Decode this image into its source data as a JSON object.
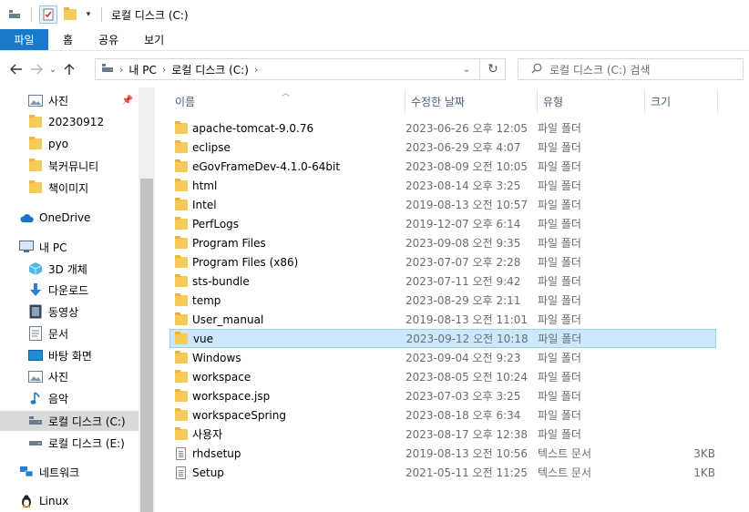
{
  "window": {
    "title": "로컬 디스크 (C:)"
  },
  "ribbon": {
    "tabs": [
      "파일",
      "홈",
      "공유",
      "보기"
    ]
  },
  "address": {
    "crumbs": [
      "내 PC",
      "로컬 디스크 (C:)"
    ],
    "search_placeholder": "로컬 디스크 (C:) 검색"
  },
  "nav": {
    "quick_access": [
      {
        "label": "사진",
        "icon": "pictures-icon",
        "pinned": true
      },
      {
        "label": "20230912",
        "icon": "folder-icon"
      },
      {
        "label": "pyo",
        "icon": "folder-icon"
      },
      {
        "label": "북커뮤니티",
        "icon": "folder-icon"
      },
      {
        "label": "책이미지",
        "icon": "folder-icon"
      }
    ],
    "onedrive": "OneDrive",
    "this_pc": "내 PC",
    "pc_items": [
      {
        "label": "3D 개체",
        "icon": "3d-objects-icon"
      },
      {
        "label": "다운로드",
        "icon": "downloads-icon"
      },
      {
        "label": "동영상",
        "icon": "videos-icon"
      },
      {
        "label": "문서",
        "icon": "documents-icon"
      },
      {
        "label": "바탕 화면",
        "icon": "desktop-icon"
      },
      {
        "label": "사진",
        "icon": "pictures-icon"
      },
      {
        "label": "음악",
        "icon": "music-icon"
      },
      {
        "label": "로컬 디스크 (C:)",
        "icon": "drive-icon",
        "selected": true
      },
      {
        "label": "로컬 디스크 (E:)",
        "icon": "drive-icon"
      }
    ],
    "network": "네트워크",
    "linux": "Linux"
  },
  "columns": {
    "name": "이름",
    "date": "수정한 날짜",
    "type": "유형",
    "size": "크기"
  },
  "files": [
    {
      "name": "apache-tomcat-9.0.76",
      "date": "2023-06-26 오후 12:05",
      "type": "파일 폴더",
      "size": "",
      "kind": "folder"
    },
    {
      "name": "eclipse",
      "date": "2023-06-29 오후 4:07",
      "type": "파일 폴더",
      "size": "",
      "kind": "folder"
    },
    {
      "name": "eGovFrameDev-4.1.0-64bit",
      "date": "2023-08-09 오전 10:05",
      "type": "파일 폴더",
      "size": "",
      "kind": "folder"
    },
    {
      "name": "html",
      "date": "2023-08-14 오후 3:25",
      "type": "파일 폴더",
      "size": "",
      "kind": "folder"
    },
    {
      "name": "Intel",
      "date": "2019-08-13 오전 10:57",
      "type": "파일 폴더",
      "size": "",
      "kind": "folder"
    },
    {
      "name": "PerfLogs",
      "date": "2019-12-07 오후 6:14",
      "type": "파일 폴더",
      "size": "",
      "kind": "folder"
    },
    {
      "name": "Program Files",
      "date": "2023-09-08 오전 9:35",
      "type": "파일 폴더",
      "size": "",
      "kind": "folder"
    },
    {
      "name": "Program Files (x86)",
      "date": "2023-07-07 오후 2:28",
      "type": "파일 폴더",
      "size": "",
      "kind": "folder"
    },
    {
      "name": "sts-bundle",
      "date": "2023-07-11 오전 9:42",
      "type": "파일 폴더",
      "size": "",
      "kind": "folder"
    },
    {
      "name": "temp",
      "date": "2023-08-29 오후 2:11",
      "type": "파일 폴더",
      "size": "",
      "kind": "folder"
    },
    {
      "name": "User_manual",
      "date": "2019-08-13 오전 11:01",
      "type": "파일 폴더",
      "size": "",
      "kind": "folder"
    },
    {
      "name": "vue",
      "date": "2023-09-12 오전 10:18",
      "type": "파일 폴더",
      "size": "",
      "kind": "folder",
      "selected": true
    },
    {
      "name": "Windows",
      "date": "2023-09-04 오전 9:23",
      "type": "파일 폴더",
      "size": "",
      "kind": "folder"
    },
    {
      "name": "workspace",
      "date": "2023-08-05 오전 10:24",
      "type": "파일 폴더",
      "size": "",
      "kind": "folder"
    },
    {
      "name": "workspace.jsp",
      "date": "2023-07-03 오후 3:25",
      "type": "파일 폴더",
      "size": "",
      "kind": "folder"
    },
    {
      "name": "workspaceSpring",
      "date": "2023-08-18 오후 6:34",
      "type": "파일 폴더",
      "size": "",
      "kind": "folder"
    },
    {
      "name": "사용자",
      "date": "2023-08-17 오후 12:38",
      "type": "파일 폴더",
      "size": "",
      "kind": "folder"
    },
    {
      "name": "rhdsetup",
      "date": "2019-08-13 오전 10:56",
      "type": "텍스트 문서",
      "size": "3KB",
      "kind": "text"
    },
    {
      "name": "Setup",
      "date": "2021-05-11 오전 11:25",
      "type": "텍스트 문서",
      "size": "1KB",
      "kind": "text"
    }
  ]
}
